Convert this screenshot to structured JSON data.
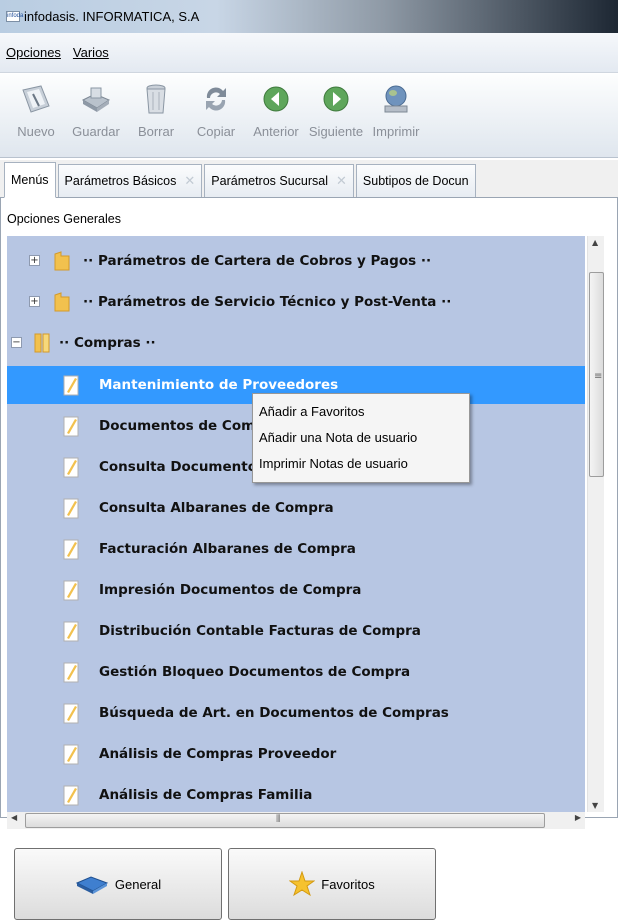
{
  "window": {
    "title": "infodasis. INFORMATICA, S.A",
    "icon_text": "infoda"
  },
  "menubar": {
    "items": [
      "Opciones",
      "Varios"
    ]
  },
  "toolbar": {
    "buttons": [
      {
        "label": "Nuevo",
        "icon": "new-icon"
      },
      {
        "label": "Guardar",
        "icon": "save-icon"
      },
      {
        "label": "Borrar",
        "icon": "trash-icon"
      },
      {
        "label": "Copiar",
        "icon": "copy-icon"
      },
      {
        "label": "Anterior",
        "icon": "previous-icon"
      },
      {
        "label": "Siguiente",
        "icon": "next-icon"
      },
      {
        "label": "Imprimir",
        "icon": "print-icon"
      }
    ]
  },
  "tabs": [
    {
      "label": "Menús",
      "active": true
    },
    {
      "label": "Parámetros Básicos"
    },
    {
      "label": "Parámetros Sucursal"
    },
    {
      "label": "Subtipos de Docun"
    }
  ],
  "panel": {
    "title": "Opciones Generales"
  },
  "tree": {
    "nodes": [
      {
        "label": "·· Parámetros de Cartera de Cobros y Pagos ··",
        "kind": "folder-collapsed"
      },
      {
        "label": "·· Parámetros de Servicio Técnico y Post-Venta ··",
        "kind": "folder-collapsed"
      },
      {
        "label": "·· Compras ··",
        "kind": "folder-open"
      },
      {
        "label": "Mantenimiento de Proveedores",
        "kind": "doc",
        "selected": true
      },
      {
        "label": "Documentos de Compra",
        "kind": "doc"
      },
      {
        "label": "Consulta Documentos de Compra",
        "kind": "doc"
      },
      {
        "label": "Consulta Albaranes de Compra",
        "kind": "doc"
      },
      {
        "label": "Facturación Albaranes de Compra",
        "kind": "doc"
      },
      {
        "label": "Impresión Documentos de Compra",
        "kind": "doc"
      },
      {
        "label": "Distribución Contable Facturas de Compra",
        "kind": "doc"
      },
      {
        "label": "Gestión Bloqueo Documentos de Compra",
        "kind": "doc"
      },
      {
        "label": "Búsqueda de Art. en Documentos de Compras",
        "kind": "doc"
      },
      {
        "label": "Análisis de Compras Proveedor",
        "kind": "doc"
      },
      {
        "label": "Análisis de Compras Familia",
        "kind": "doc"
      }
    ]
  },
  "context_menu": {
    "items": [
      "Añadir a Favoritos",
      "Añadir una Nota de usuario",
      "Imprimir Notas de usuario"
    ]
  },
  "bottom_buttons": [
    {
      "label": "General",
      "icon": "book-icon"
    },
    {
      "label": "Favoritos",
      "icon": "star-icon"
    }
  ],
  "colors": {
    "tree_bg": "#b7c6e3",
    "selection": "#3399ff",
    "folder": "#f2c14e"
  }
}
